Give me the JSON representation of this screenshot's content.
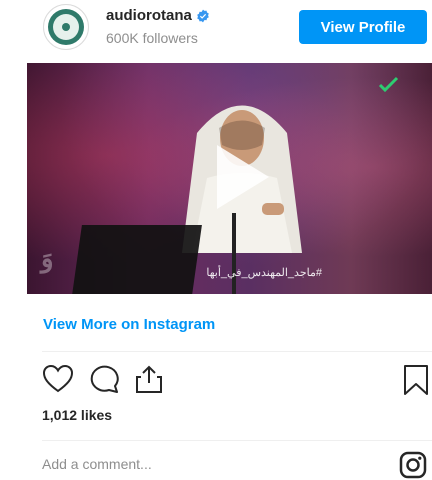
{
  "header": {
    "username": "audiorotana",
    "followers": "600K followers",
    "view_profile_label": "View Profile"
  },
  "media": {
    "caption": "#ماجد_المهندس_في_أبها",
    "corner_logo": "وَ"
  },
  "links": {
    "view_more": "View More on Instagram"
  },
  "engagement": {
    "likes": "1,012 likes"
  },
  "comment": {
    "placeholder": "Add a comment..."
  },
  "colors": {
    "accent": "#0095f6",
    "text": "#262626",
    "muted": "#8e8e8e"
  },
  "icons": [
    "verified-badge-icon",
    "play-icon",
    "heart-icon",
    "comment-icon",
    "share-icon",
    "bookmark-icon",
    "instagram-icon"
  ]
}
